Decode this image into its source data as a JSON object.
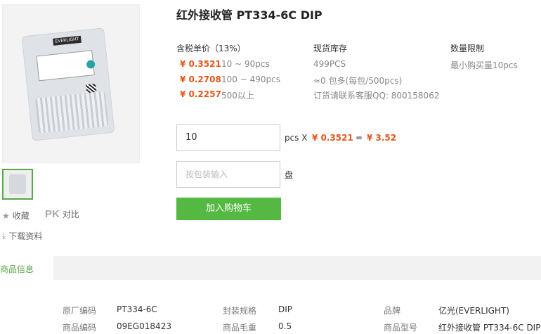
{
  "product": {
    "title": "红外接收管 PT334-6C DIP",
    "image_brand": "EVERLIGHT"
  },
  "price": {
    "header": "含税单价（13%）",
    "tiers": [
      {
        "price": "¥ 0.3521",
        "range": "10 ~ 90pcs"
      },
      {
        "price": "¥ 0.2708",
        "range": "100 ~ 490pcs"
      },
      {
        "price": "¥ 0.2257",
        "range": "500以上"
      }
    ]
  },
  "stock": {
    "header": "现货库存",
    "lines": [
      "499PCS",
      "≈0 包多(每包/500pcs)",
      "订货请联系客服QQ: 800158062"
    ]
  },
  "limit": {
    "header": "数量限制",
    "text": "最小购买量10pcs"
  },
  "order": {
    "qty_value": "10",
    "unit": "pcs X",
    "unit_price": "¥ 0.3521",
    "equals": "=",
    "total": "¥ 3.52",
    "package_placeholder": "按包装输入",
    "package_unit": "盘",
    "add_to_cart": "加入购物车"
  },
  "side": {
    "favorite": "收藏",
    "pk": "PK",
    "compare": "对比",
    "download": "下载资料"
  },
  "tabs": {
    "active": "商品信息"
  },
  "specs": [
    {
      "label": "原厂编码",
      "value": "PT334-6C"
    },
    {
      "label": "封装规格",
      "value": "DIP"
    },
    {
      "label": "品牌",
      "value": "亿光(EVERLIGHT)"
    },
    {
      "label": "商品编码",
      "value": "09EG018423"
    },
    {
      "label": "商品毛重",
      "value": "0.5"
    },
    {
      "label": "商品型号",
      "value": "红外接收管 PT334-6C DIP"
    }
  ],
  "colors": {
    "accent_green": "#54b842",
    "price_orange": "#e4571b"
  }
}
